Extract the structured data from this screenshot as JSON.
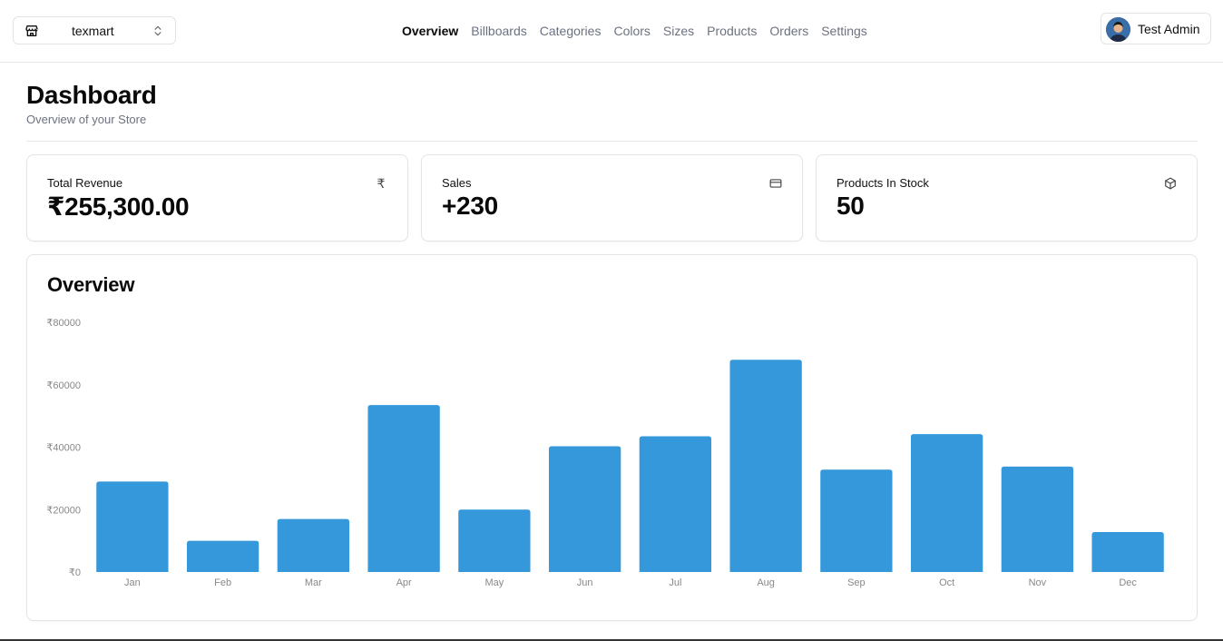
{
  "store": {
    "name": "texmart",
    "icon": "store-icon",
    "chevron_icon": "chevrons-up-down-icon"
  },
  "nav": {
    "items": [
      {
        "label": "Overview",
        "active": true
      },
      {
        "label": "Billboards",
        "active": false
      },
      {
        "label": "Categories",
        "active": false
      },
      {
        "label": "Colors",
        "active": false
      },
      {
        "label": "Sizes",
        "active": false
      },
      {
        "label": "Products",
        "active": false
      },
      {
        "label": "Orders",
        "active": false
      },
      {
        "label": "Settings",
        "active": false
      }
    ]
  },
  "user": {
    "name": "Test Admin",
    "avatar": "user-avatar"
  },
  "page": {
    "title": "Dashboard",
    "subtitle": "Overview of your Store"
  },
  "stats": [
    {
      "label": "Total Revenue",
      "value": "₹255,300.00",
      "icon": "rupee-icon"
    },
    {
      "label": "Sales",
      "value": "+230",
      "icon": "credit-card-icon"
    },
    {
      "label": "Products In Stock",
      "value": "50",
      "icon": "package-icon"
    }
  ],
  "overview": {
    "title": "Overview"
  },
  "colors": {
    "bar": "#3498db",
    "axis_text": "#888888",
    "border": "#e2e4e8"
  },
  "chart_data": {
    "type": "bar",
    "title": "",
    "xlabel": "",
    "ylabel": "",
    "categories": [
      "Jan",
      "Feb",
      "Mar",
      "Apr",
      "May",
      "Jun",
      "Jul",
      "Aug",
      "Sep",
      "Oct",
      "Nov",
      "Dec"
    ],
    "values": [
      29000,
      10000,
      17000,
      53500,
      20000,
      40300,
      43500,
      68000,
      32800,
      44200,
      33800,
      12800
    ],
    "yticks": [
      "₹0",
      "₹20000",
      "₹40000",
      "₹60000",
      "₹80000"
    ],
    "ylim": [
      0,
      80000
    ],
    "grid": false,
    "legend": "none"
  }
}
